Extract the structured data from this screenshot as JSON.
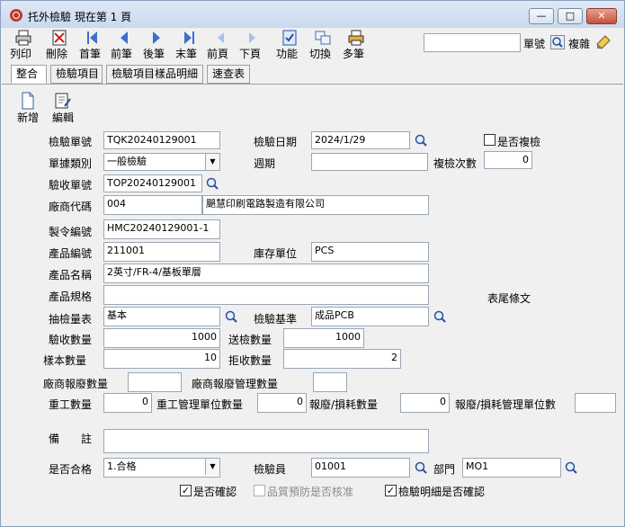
{
  "window": {
    "title": "托外檢驗 現在第 1 頁",
    "min_label": "—",
    "max_label": "□",
    "close_label": "✕"
  },
  "toolbar": {
    "items": [
      {
        "label": "列印",
        "icon": "printer-icon"
      },
      {
        "label": "刪除",
        "icon": "delete-icon"
      },
      {
        "label": "首筆",
        "icon": "first-record-icon"
      },
      {
        "label": "前筆",
        "icon": "prev-record-icon"
      },
      {
        "label": "後筆",
        "icon": "next-record-icon"
      },
      {
        "label": "末筆",
        "icon": "last-record-icon"
      },
      {
        "label": "前頁",
        "icon": "prev-page-icon"
      },
      {
        "label": "下頁",
        "icon": "next-page-icon"
      },
      {
        "label": "功能",
        "icon": "function-icon"
      },
      {
        "label": "切換",
        "icon": "switch-icon"
      },
      {
        "label": "多筆",
        "icon": "multi-record-icon"
      }
    ],
    "search_value": "",
    "search_label": "單號",
    "copy_label": "複雜"
  },
  "tabs": [
    "整合",
    "檢驗項目",
    "檢驗項目樣品明細",
    "速查表"
  ],
  "subtoolbar": {
    "new_label": "新增",
    "edit_label": "編輯"
  },
  "form": {
    "inspection_no_label": "檢驗單號",
    "inspection_no": "TQK20240129001",
    "inspection_date_label": "檢驗日期",
    "inspection_date": "2024/1/29",
    "reinspect_label": "是否複檢",
    "doc_type_label": "單據類別",
    "doc_type": "一般檢驗",
    "cycle_label": "週期",
    "cycle": "",
    "reinspect_count_label": "複檢次數",
    "reinspect_count": "0",
    "receipt_no_label": "驗收單號",
    "receipt_no": "TOP20240129001",
    "vendor_code_label": "廠商代碼",
    "vendor_code": "004",
    "vendor_name": "颶慧印刷電路製造有限公司",
    "mo_no_label": "製令編號",
    "mo_no": "HMC20240129001-1",
    "product_no_label": "產品編號",
    "product_no": "211001",
    "stock_unit_label": "庫存單位",
    "stock_unit": "PCS",
    "product_name_label": "產品名稱",
    "product_name": "2英寸/FR-4/基板單層",
    "product_spec_label": "產品規格",
    "product_spec": "",
    "footer_terms_label": "表尾條文",
    "sampling_table_label": "抽檢量表",
    "sampling_table": "基本",
    "inspection_standard_label": "檢驗基準",
    "inspection_standard": "成品PCB",
    "receipt_qty_label": "驗收數量",
    "receipt_qty": "1000",
    "sent_qty_label": "送檢數量",
    "sent_qty": "1000",
    "sample_qty_label": "樣本數量",
    "sample_qty": "10",
    "reject_qty_label": "拒收數量",
    "reject_qty": "2",
    "vendor_scrap_qty_label": "廠商報廢數量",
    "vendor_scrap_qty": "",
    "vendor_scrap_mgmt_qty_label": "廠商報廢管理數量",
    "vendor_scrap_mgmt_qty": "",
    "rework_qty_label": "重工數量",
    "rework_qty": "0",
    "rework_mgmt_qty_label": "重工管理單位數量",
    "rework_mgmt_qty": "0",
    "scrap_loss_qty_label": "報廢/損耗數量",
    "scrap_loss_qty": "0",
    "scrap_loss_mgmt_qty_label": "報廢/損耗管理單位數",
    "scrap_loss_mgmt_qty": "",
    "remark_label": "備　　註",
    "remark": "",
    "pass_label": "是否合格",
    "pass": "1.合格",
    "inspector_label": "檢驗員",
    "inspector": "01001",
    "dept_label": "部門",
    "dept": "MO1",
    "confirmed_label": "是否確認",
    "qa_prevention_label": "品質預防是否核准",
    "detail_confirmed_label": "檢驗明細是否確認"
  }
}
